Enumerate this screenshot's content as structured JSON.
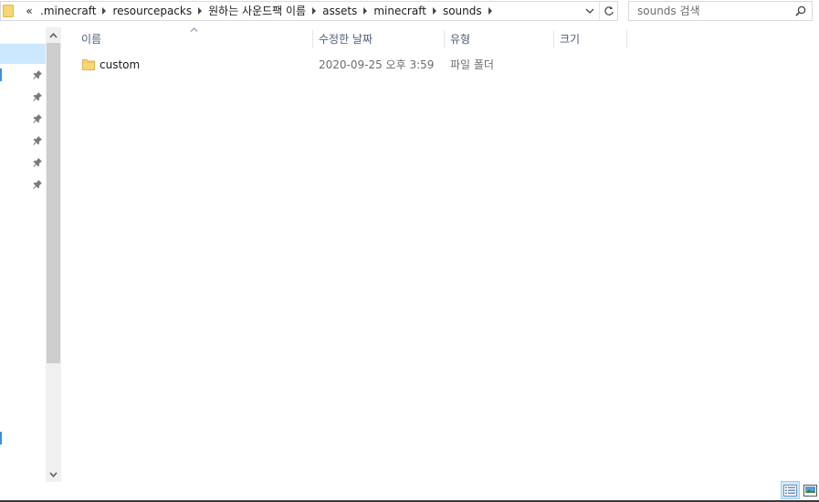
{
  "address_bar": {
    "overflow_label": "«",
    "breadcrumbs": [
      ".minecraft",
      "resourcepacks",
      "원하는 사운드팩 이름",
      "assets",
      "minecraft",
      "sounds"
    ]
  },
  "search": {
    "placeholder": "sounds 검색"
  },
  "columns": {
    "name": "이름",
    "date": "수정한 날짜",
    "type": "유형",
    "size": "크기"
  },
  "files": [
    {
      "name": "custom",
      "date": "2020-09-25 오후 3:59",
      "type": "파일 폴더",
      "size": "",
      "icon": "folder-icon"
    }
  ],
  "nav_pane": {
    "pinned_count": 6
  },
  "colors": {
    "selection": "#cce8ff",
    "header_text": "#4c607a",
    "folder": "#f7d774",
    "thumb": "#cdcdcd"
  }
}
